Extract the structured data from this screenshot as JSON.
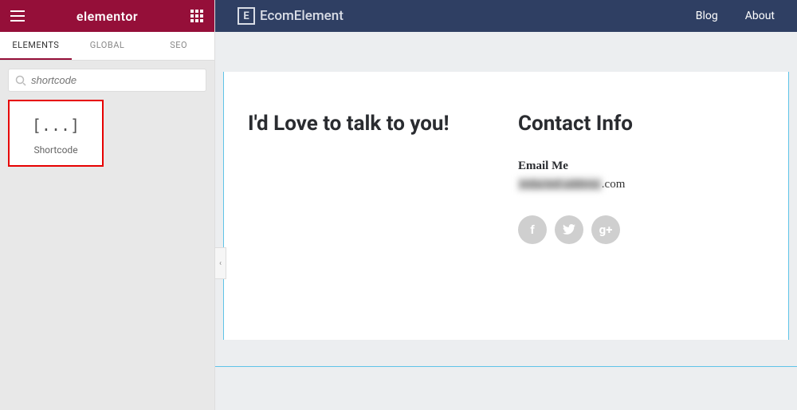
{
  "panel": {
    "brand": "elementor",
    "tabs": {
      "elements": "ELEMENTS",
      "global": "GLOBAL",
      "seo": "SEO"
    },
    "search_placeholder": "shortcode",
    "widget": {
      "icon": "[...]",
      "label": "Shortcode"
    }
  },
  "site": {
    "logo_mark": "E",
    "logo_text": "EcomElement",
    "nav": {
      "blog": "Blog",
      "about": "About"
    }
  },
  "page": {
    "left_heading": "I'd Love to talk to you!",
    "right_heading": "Contact Info",
    "email_label": "Email Me",
    "email_blur": "redacted-address",
    "email_suffix": ".com",
    "social": {
      "fb": "f",
      "tw": "t",
      "gp": "g+"
    }
  },
  "collapse_glyph": "‹"
}
